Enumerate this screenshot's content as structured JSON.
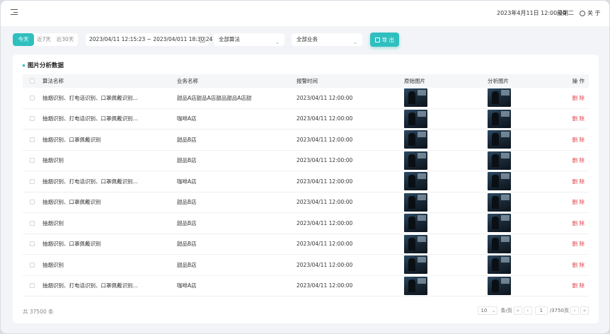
{
  "header": {
    "datetime": "2023年4月11日 12:00:00",
    "weekday": "星期二",
    "about_label": "关 于"
  },
  "filters": {
    "tabs": [
      {
        "label": "今天"
      },
      {
        "label": "近7天"
      },
      {
        "label": "近30天"
      }
    ],
    "date_range": "2023/04/11   12:15:23  ~  2023/04/011 18:30:24",
    "algorithm_select": "全部算法",
    "business_select": "全部业务",
    "export_label": "导 出"
  },
  "card": {
    "title": "图片分析数据",
    "columns": {
      "algorithm": "算法名称",
      "business": "业务名称",
      "time": "报警时间",
      "original": "原始图片",
      "analysis": "分析图片",
      "action": "操 作"
    },
    "rows": [
      {
        "algorithm": "抽烟识别、打电话识别、口罩佩戴识别...",
        "business": "甜品A店甜品A店甜品甜品A店甜",
        "time": "2023/04/11 12:00:00",
        "action": "删 除"
      },
      {
        "algorithm": "抽烟识别、打电话识别、口罩佩戴识别...",
        "business": "咖啡A店",
        "time": "2023/04/11 12:00:00",
        "action": "删 除"
      },
      {
        "algorithm": "抽烟识别、口罩佩戴识别",
        "business": "甜品B店",
        "time": "2023/04/11 12:00:00",
        "action": "删 除"
      },
      {
        "algorithm": "抽烟识别",
        "business": "甜品B店",
        "time": "2023/04/11 12:00:00",
        "action": "删 除"
      },
      {
        "algorithm": "抽烟识别、打电话识别、口罩佩戴识别...",
        "business": "咖啡A店",
        "time": "2023/04/11 12:00:00",
        "action": "删 除"
      },
      {
        "algorithm": "抽烟识别、口罩佩戴识别",
        "business": "甜品B店",
        "time": "2023/04/11 12:00:00",
        "action": "删 除"
      },
      {
        "algorithm": "抽烟识别",
        "business": "甜品B店",
        "time": "2023/04/11 12:00:00",
        "action": "删 除"
      },
      {
        "algorithm": "抽烟识别、口罩佩戴识别",
        "business": "甜品B店",
        "time": "2023/04/11 12:00:00",
        "action": "删 除"
      },
      {
        "algorithm": "抽烟识别",
        "business": "甜品B店",
        "time": "2023/04/11 12:00:00",
        "action": "删 除"
      },
      {
        "algorithm": "抽烟识别、打电话识别、口罩佩戴识别...",
        "business": "咖啡A店",
        "time": "2023/04/11 12:00:00",
        "action": "删 除"
      }
    ],
    "total": "共 37500 条",
    "pagination": {
      "page_size": "10",
      "per_page_label": "条/页",
      "first": "«",
      "prev": "‹",
      "current": "1",
      "pages_label": "/3750页",
      "next": "›",
      "last": "»"
    }
  }
}
